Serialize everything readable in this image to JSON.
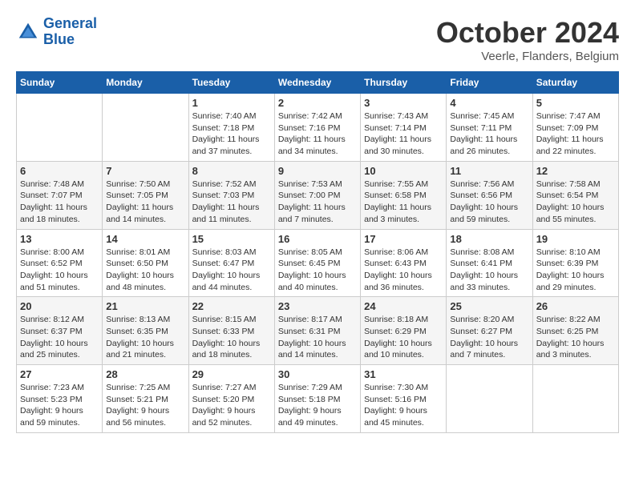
{
  "header": {
    "logo_line1": "General",
    "logo_line2": "Blue",
    "month_title": "October 2024",
    "subtitle": "Veerle, Flanders, Belgium"
  },
  "weekdays": [
    "Sunday",
    "Monday",
    "Tuesday",
    "Wednesday",
    "Thursday",
    "Friday",
    "Saturday"
  ],
  "weeks": [
    [
      {
        "day": "",
        "info": ""
      },
      {
        "day": "",
        "info": ""
      },
      {
        "day": "1",
        "info": "Sunrise: 7:40 AM\nSunset: 7:18 PM\nDaylight: 11 hours and 37 minutes."
      },
      {
        "day": "2",
        "info": "Sunrise: 7:42 AM\nSunset: 7:16 PM\nDaylight: 11 hours and 34 minutes."
      },
      {
        "day": "3",
        "info": "Sunrise: 7:43 AM\nSunset: 7:14 PM\nDaylight: 11 hours and 30 minutes."
      },
      {
        "day": "4",
        "info": "Sunrise: 7:45 AM\nSunset: 7:11 PM\nDaylight: 11 hours and 26 minutes."
      },
      {
        "day": "5",
        "info": "Sunrise: 7:47 AM\nSunset: 7:09 PM\nDaylight: 11 hours and 22 minutes."
      }
    ],
    [
      {
        "day": "6",
        "info": "Sunrise: 7:48 AM\nSunset: 7:07 PM\nDaylight: 11 hours and 18 minutes."
      },
      {
        "day": "7",
        "info": "Sunrise: 7:50 AM\nSunset: 7:05 PM\nDaylight: 11 hours and 14 minutes."
      },
      {
        "day": "8",
        "info": "Sunrise: 7:52 AM\nSunset: 7:03 PM\nDaylight: 11 hours and 11 minutes."
      },
      {
        "day": "9",
        "info": "Sunrise: 7:53 AM\nSunset: 7:00 PM\nDaylight: 11 hours and 7 minutes."
      },
      {
        "day": "10",
        "info": "Sunrise: 7:55 AM\nSunset: 6:58 PM\nDaylight: 11 hours and 3 minutes."
      },
      {
        "day": "11",
        "info": "Sunrise: 7:56 AM\nSunset: 6:56 PM\nDaylight: 10 hours and 59 minutes."
      },
      {
        "day": "12",
        "info": "Sunrise: 7:58 AM\nSunset: 6:54 PM\nDaylight: 10 hours and 55 minutes."
      }
    ],
    [
      {
        "day": "13",
        "info": "Sunrise: 8:00 AM\nSunset: 6:52 PM\nDaylight: 10 hours and 51 minutes."
      },
      {
        "day": "14",
        "info": "Sunrise: 8:01 AM\nSunset: 6:50 PM\nDaylight: 10 hours and 48 minutes."
      },
      {
        "day": "15",
        "info": "Sunrise: 8:03 AM\nSunset: 6:47 PM\nDaylight: 10 hours and 44 minutes."
      },
      {
        "day": "16",
        "info": "Sunrise: 8:05 AM\nSunset: 6:45 PM\nDaylight: 10 hours and 40 minutes."
      },
      {
        "day": "17",
        "info": "Sunrise: 8:06 AM\nSunset: 6:43 PM\nDaylight: 10 hours and 36 minutes."
      },
      {
        "day": "18",
        "info": "Sunrise: 8:08 AM\nSunset: 6:41 PM\nDaylight: 10 hours and 33 minutes."
      },
      {
        "day": "19",
        "info": "Sunrise: 8:10 AM\nSunset: 6:39 PM\nDaylight: 10 hours and 29 minutes."
      }
    ],
    [
      {
        "day": "20",
        "info": "Sunrise: 8:12 AM\nSunset: 6:37 PM\nDaylight: 10 hours and 25 minutes."
      },
      {
        "day": "21",
        "info": "Sunrise: 8:13 AM\nSunset: 6:35 PM\nDaylight: 10 hours and 21 minutes."
      },
      {
        "day": "22",
        "info": "Sunrise: 8:15 AM\nSunset: 6:33 PM\nDaylight: 10 hours and 18 minutes."
      },
      {
        "day": "23",
        "info": "Sunrise: 8:17 AM\nSunset: 6:31 PM\nDaylight: 10 hours and 14 minutes."
      },
      {
        "day": "24",
        "info": "Sunrise: 8:18 AM\nSunset: 6:29 PM\nDaylight: 10 hours and 10 minutes."
      },
      {
        "day": "25",
        "info": "Sunrise: 8:20 AM\nSunset: 6:27 PM\nDaylight: 10 hours and 7 minutes."
      },
      {
        "day": "26",
        "info": "Sunrise: 8:22 AM\nSunset: 6:25 PM\nDaylight: 10 hours and 3 minutes."
      }
    ],
    [
      {
        "day": "27",
        "info": "Sunrise: 7:23 AM\nSunset: 5:23 PM\nDaylight: 9 hours and 59 minutes."
      },
      {
        "day": "28",
        "info": "Sunrise: 7:25 AM\nSunset: 5:21 PM\nDaylight: 9 hours and 56 minutes."
      },
      {
        "day": "29",
        "info": "Sunrise: 7:27 AM\nSunset: 5:20 PM\nDaylight: 9 hours and 52 minutes."
      },
      {
        "day": "30",
        "info": "Sunrise: 7:29 AM\nSunset: 5:18 PM\nDaylight: 9 hours and 49 minutes."
      },
      {
        "day": "31",
        "info": "Sunrise: 7:30 AM\nSunset: 5:16 PM\nDaylight: 9 hours and 45 minutes."
      },
      {
        "day": "",
        "info": ""
      },
      {
        "day": "",
        "info": ""
      }
    ]
  ]
}
